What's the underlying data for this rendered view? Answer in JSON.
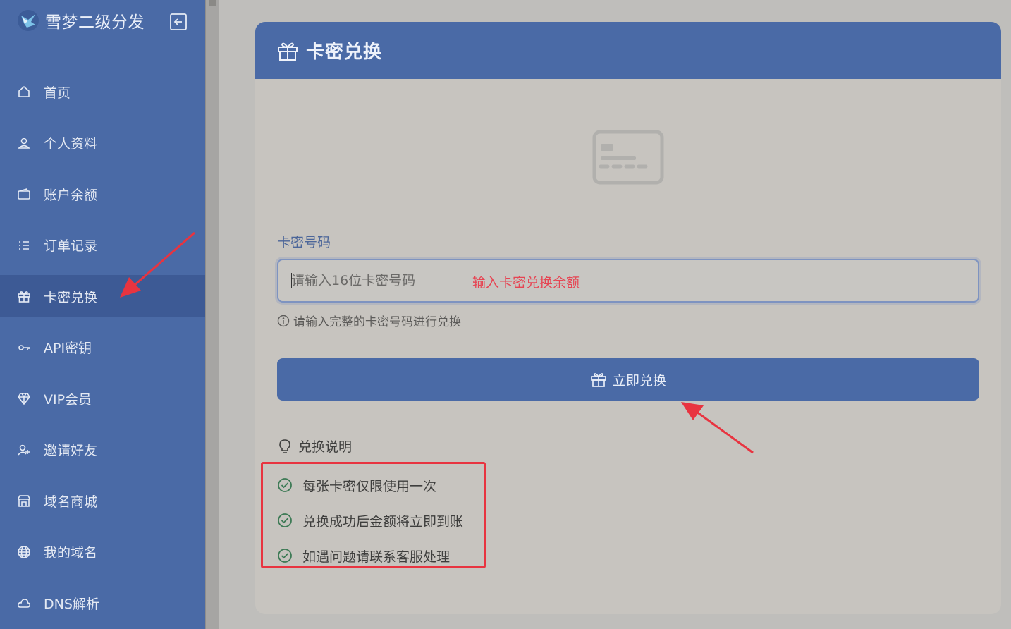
{
  "app": {
    "title": "雪梦二级分发"
  },
  "sidebar": {
    "items": [
      {
        "label": "首页",
        "icon": "home-icon",
        "active": false
      },
      {
        "label": "个人资料",
        "icon": "user-icon",
        "active": false
      },
      {
        "label": "账户余额",
        "icon": "wallet-icon",
        "active": false
      },
      {
        "label": "订单记录",
        "icon": "list-icon",
        "active": false
      },
      {
        "label": "卡密兑换",
        "icon": "gift-icon",
        "active": true
      },
      {
        "label": "API密钥",
        "icon": "key-icon",
        "active": false
      },
      {
        "label": "VIP会员",
        "icon": "diamond-icon",
        "active": false
      },
      {
        "label": "邀请好友",
        "icon": "user-plus-icon",
        "active": false
      },
      {
        "label": "域名商城",
        "icon": "store-icon",
        "active": false
      },
      {
        "label": "我的域名",
        "icon": "globe-icon",
        "active": false
      },
      {
        "label": "DNS解析",
        "icon": "cloud-icon",
        "active": false
      }
    ]
  },
  "card": {
    "title": "卡密兑换",
    "field_label": "卡密号码",
    "input_placeholder": "请输入16位卡密号码",
    "input_value": "",
    "annotation": "输入卡密兑换余额",
    "hint": "请输入完整的卡密号码进行兑换",
    "button_label": "立即兑换",
    "notes_title": "兑换说明",
    "notes": [
      "每张卡密仅限使用一次",
      "兑换成功后金额将立即到账",
      "如遇问题请联系客服处理"
    ]
  },
  "colors": {
    "sidebar_bg": "#4a6aa6",
    "sidebar_active_bg": "#3d5a95",
    "card_bg": "#c7c4bf",
    "accent": "#4a6aa6",
    "annotation_red": "#e83440",
    "check_green": "#3d7a55"
  }
}
